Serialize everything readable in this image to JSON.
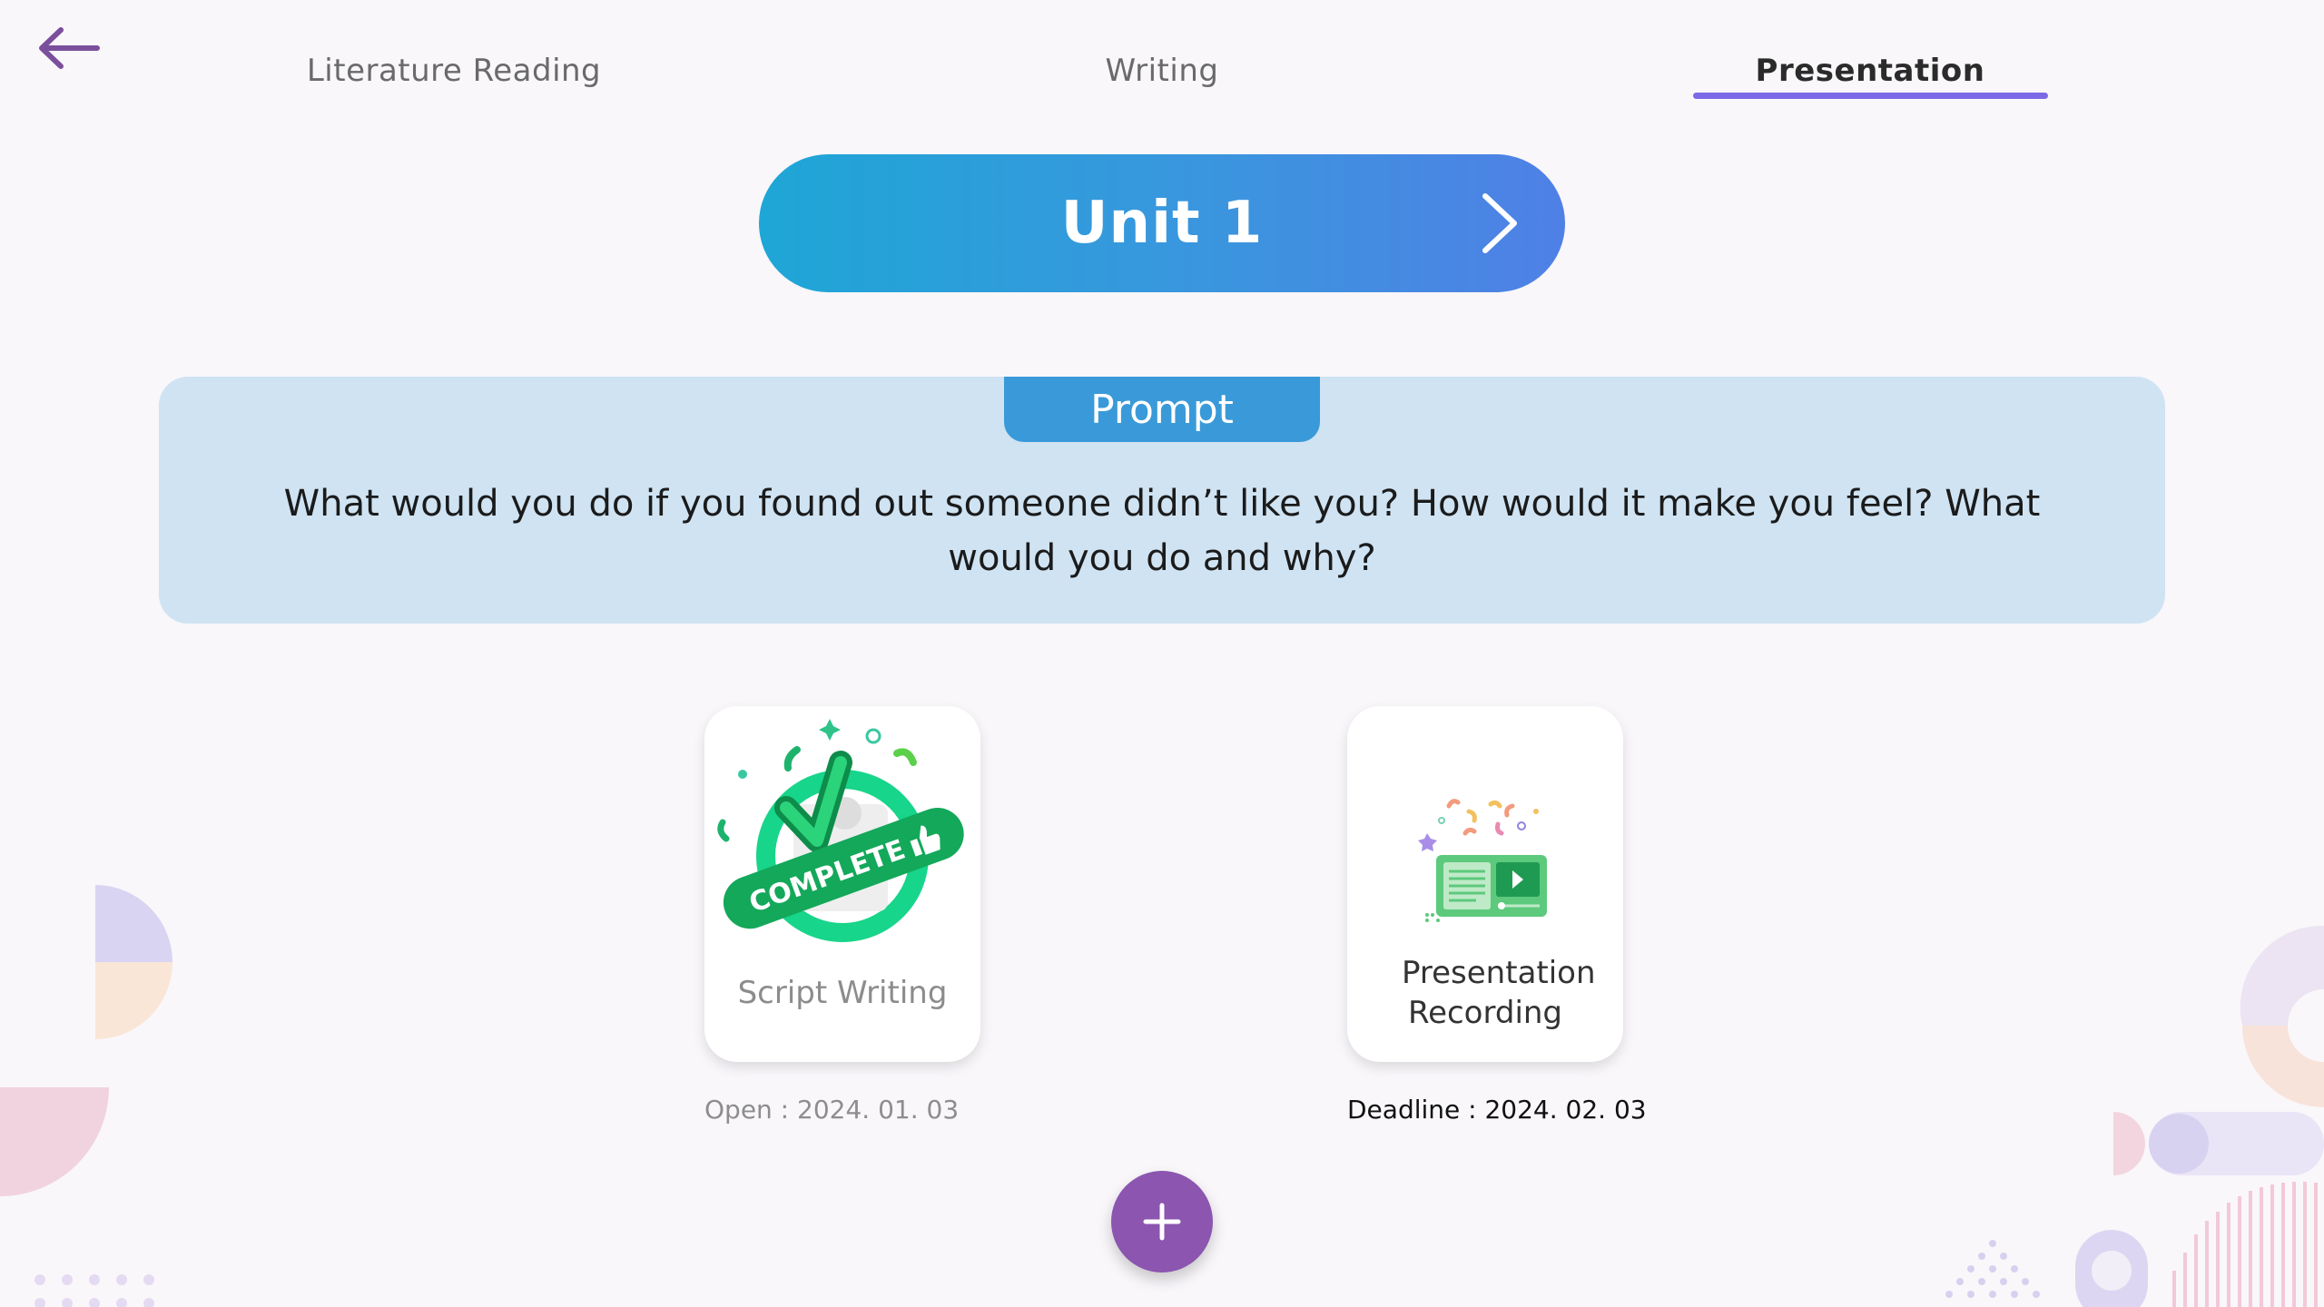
{
  "tabs": [
    {
      "label": "Literature Reading",
      "active": false
    },
    {
      "label": "Writing",
      "active": false
    },
    {
      "label": "Presentation",
      "active": true
    }
  ],
  "unit": {
    "title": "Unit 1"
  },
  "prompt": {
    "header": "Prompt",
    "text": "What would you do if you found out someone didn’t like you? How would it make you feel? What would you do and why?"
  },
  "cards": [
    {
      "label": "Script Writing",
      "badge": "COMPLETE",
      "date_text": "Open : 2024. 01. 03",
      "icon": "complete-badge-icon"
    },
    {
      "label": "Presentation Recording",
      "date_text": "Deadline : 2024. 02. 03",
      "icon": "video-recording-icon"
    }
  ],
  "icons": {
    "back": "arrow-left-icon",
    "unit_next": "chevron-right-icon",
    "add": "plus-icon"
  },
  "colors": {
    "background": "#f9f7fa",
    "accent_purple": "#8b55b0",
    "tab_underline": "#7a6ae6",
    "unit_gradient_start": "#1ea6d6",
    "unit_gradient_end": "#4f80e6",
    "prompt_panel": "#cfe3f3",
    "prompt_header": "#3a9ad9",
    "complete_green": "#13a85a"
  }
}
